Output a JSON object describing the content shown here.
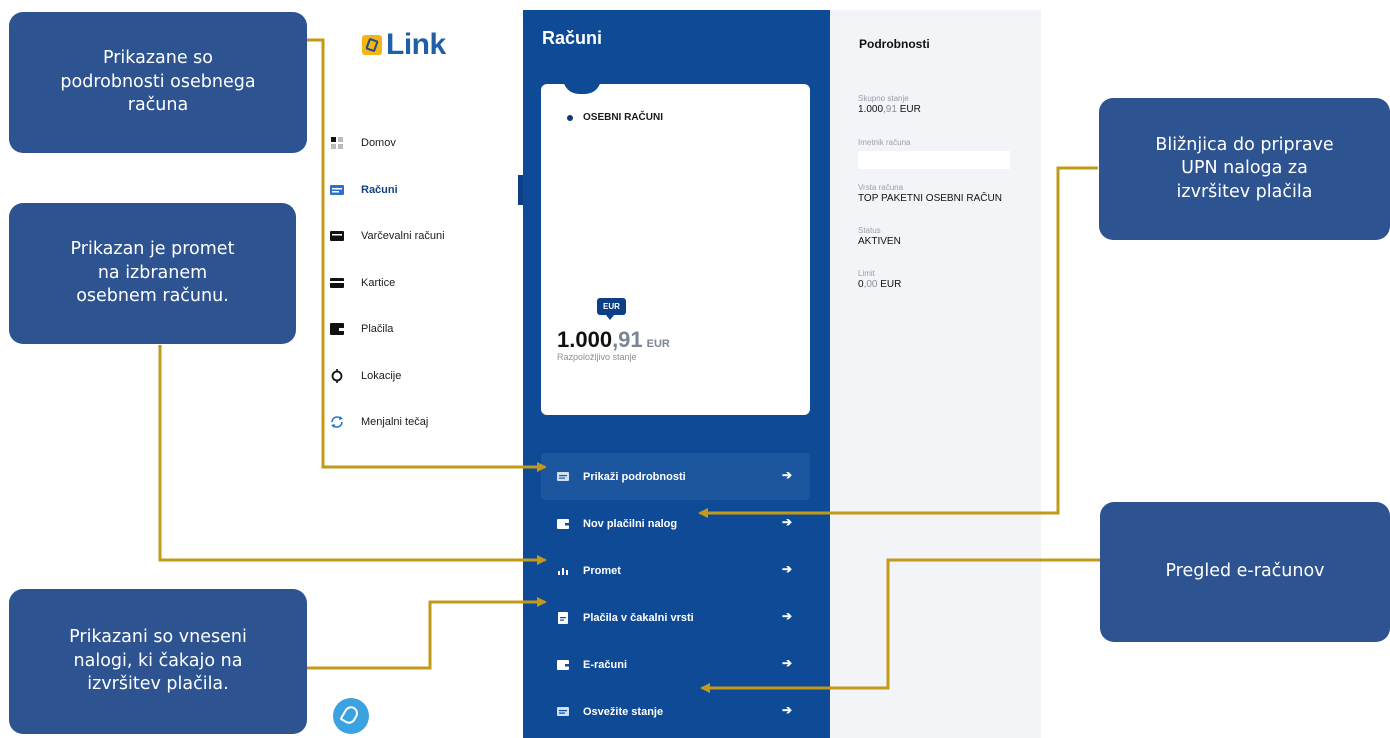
{
  "logo": {
    "text": "Link"
  },
  "sidebar": {
    "items": [
      {
        "label": "Domov",
        "icon": "dashboard-icon"
      },
      {
        "label": "Računi",
        "icon": "accounts-icon",
        "active": true
      },
      {
        "label": "Varčevalni računi",
        "icon": "savings-icon"
      },
      {
        "label": "Kartice",
        "icon": "card-icon"
      },
      {
        "label": "Plačila",
        "icon": "wallet-icon"
      },
      {
        "label": "Lokacije",
        "icon": "location-icon"
      },
      {
        "label": "Menjalni tečaj",
        "icon": "exchange-icon"
      }
    ]
  },
  "accounts": {
    "title": "Računi",
    "card": {
      "label": "OSEBNI RAČUNI",
      "currency_badge": "EUR",
      "amount_int": "1.000",
      "amount_dec": ",91",
      "amount_currency": "EUR",
      "available_label": "Razpoložljivo stanje"
    },
    "actions": [
      {
        "label": "Prikaži podrobnosti",
        "icon": "details-icon"
      },
      {
        "label": "Nov plačilni nalog",
        "icon": "new-payment-icon"
      },
      {
        "label": "Promet",
        "icon": "chart-icon"
      },
      {
        "label": "Plačila v čakalni vrsti",
        "icon": "queue-icon"
      },
      {
        "label": "E-računi",
        "icon": "e-invoice-icon"
      },
      {
        "label": "Osvežite stanje",
        "icon": "refresh-icon"
      }
    ]
  },
  "details": {
    "title": "Podrobnosti",
    "total_label": "Skupno stanje",
    "total_int": "1.000",
    "total_dec": ",91",
    "total_currency": " EUR",
    "holder_label": "Imetnik računa",
    "type_label": "Vrsta računa",
    "type_value": "TOP PAKETNI OSEBNI RAČUN",
    "status_label": "Status",
    "status_value": "AKTIVEN",
    "limit_label": "Limit",
    "limit_int": "0",
    "limit_dec": ",00",
    "limit_currency": " EUR"
  },
  "callouts": {
    "details": "Prikazane so\npodrobnosti osebnega\nračuna",
    "turnover": "Prikazan je promet\nna izbranem\nosebnem računu.",
    "queue": "Prikazani so vneseni\nnalogi, ki čakajo na\nizvršitev plačila.",
    "upn": "Bližnjica do priprave\nUPN naloga za\nizvršitev plačila",
    "einvoice": "Pregled e-računov"
  },
  "colors": {
    "panel_blue": "#0f4a96",
    "callout_blue": "#2d5391",
    "connector_gold": "#c29a1a"
  }
}
